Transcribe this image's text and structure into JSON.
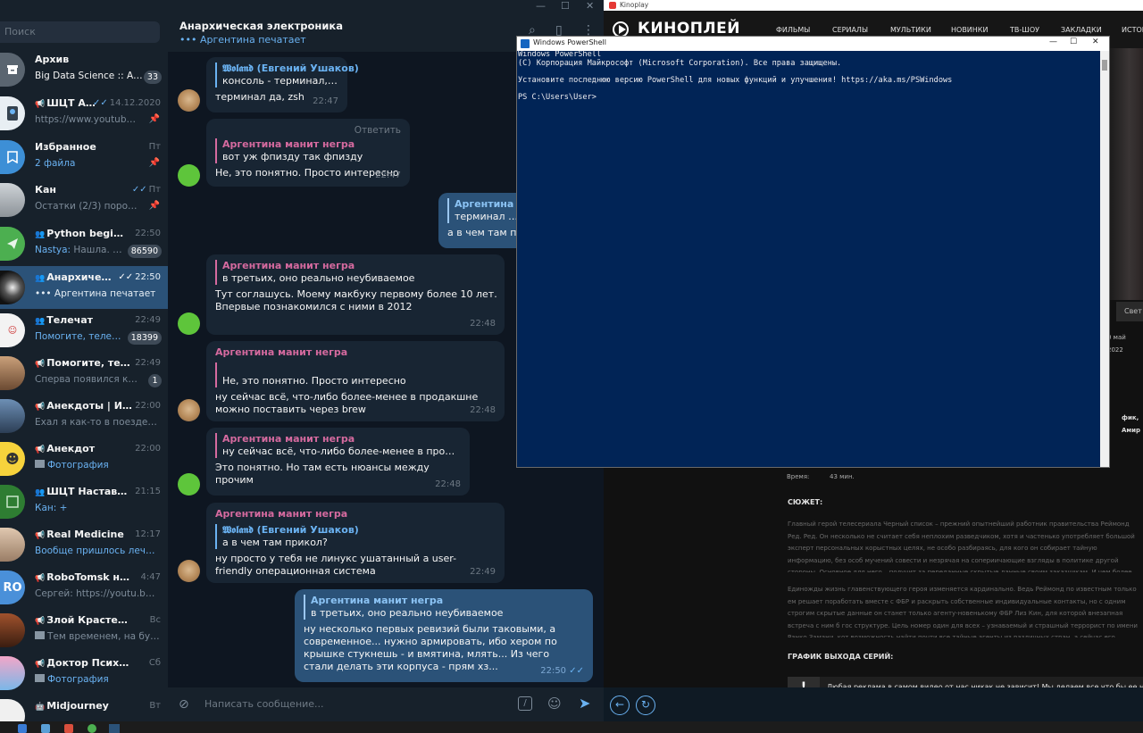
{
  "telegram": {
    "search_placeholder": "Поиск",
    "chats": [
      {
        "title": "Архив",
        "preview": "Big Data Science :: AI / ...",
        "badge": "33"
      },
      {
        "title": "ШЦТ Аси...",
        "time": "14.12.2020",
        "preview": "https://www.youtube.co..."
      },
      {
        "title": "Избранное",
        "time": "Пт",
        "preview": "2 файла"
      },
      {
        "title": "Кан",
        "time": "Пт",
        "preview": "Остатки (2/3) порошко..."
      },
      {
        "title": "Python beginners",
        "time": "22:50",
        "preview_sender": "Nastya:",
        "preview": "Нашла. Там...",
        "badge": "86590"
      },
      {
        "title": "Анархическая...",
        "time": "22:50",
        "preview": "••• Аргентина печатает"
      },
      {
        "title": "Телечат",
        "time": "22:49",
        "preview": "Помогите, телемед...",
        "badge": "18399"
      },
      {
        "title": "Помогите, телем...",
        "time": "22:49",
        "preview": "Сперва появился кише...",
        "badge": "1"
      },
      {
        "title": "Анекдоты | Исто...",
        "time": "22:00",
        "preview": "Ехал я как-то в поезде в ку..."
      },
      {
        "title": "Анекдот",
        "time": "22:00",
        "preview": "Фотография"
      },
      {
        "title": "ШЦТ Наставник...",
        "time": "21:15",
        "preview": "Кан: +"
      },
      {
        "title": "Real Medicine",
        "time": "12:17",
        "preview": "Вообще пришлось лечить ..."
      },
      {
        "title": "RoboTomsk новос...",
        "time": "4:47",
        "preview": "Сергей: https://youtu.be/3...",
        "avatar": "RO"
      },
      {
        "title": "Злой Крастер",
        "time": "Вс",
        "preview": "Тем временем, на буст..."
      },
      {
        "title": "Доктор Психтер",
        "time": "Сб",
        "preview": "Фотография"
      },
      {
        "title": "Midjourney",
        "time": "Вт",
        "preview": ""
      }
    ],
    "header": {
      "title": "Анархическая электроника",
      "status": "••• Аргентина печатает"
    },
    "messages": {
      "m1": {
        "reply_name": "𝖂𝖔𝖑𝖆𝖓𝖉 (Евгений Ушаков)",
        "reply_text": "консоль - терминал, в см...",
        "text": "терминал да, zsh",
        "time": "22:47"
      },
      "m2": {
        "reply_link": "Ответить",
        "reply_name": "Аргентина манит негра",
        "reply_text": "вот уж фпизду так фпизду",
        "text": "Не, это понятно. Просто интересно",
        "time": "22:47"
      },
      "m3": {
        "reply_name": "Аргентина ма",
        "reply_text": "терминал да, z",
        "text": "а в чем там при"
      },
      "m4": {
        "reply_name": "Аргентина манит негра",
        "reply_text": "в третьих, оно реально неубиваемое",
        "text": "Тут соглашусь. Моему макбуку первому более 10 лет. Впервые познакомился с ними в 2012",
        "time": "22:48"
      },
      "m5": {
        "sender": "Аргентина манит негра",
        "reply_text": "Не, это понятно. Просто интересно",
        "text": "ну сейчас всё, что-либо более-менее в продакшне можно поставить через brew",
        "time": "22:48"
      },
      "m6": {
        "reply_name": "Аргентина манит негра",
        "reply_text": "ну сейчас всё, что-либо более-менее в продакшне ...",
        "text": "Это понятно. Но там есть нюансы между прочим",
        "time": "22:48"
      },
      "m7": {
        "sender": "Аргентина манит негра",
        "reply_name": "𝖂𝖔𝖑𝖆𝖓𝖉 (Евгений Ушаков)",
        "reply_text": "а в чем там прикол?",
        "text": "ну просто у тебя не линукс ушатанный а user-friendly операционная система",
        "time": "22:49"
      },
      "m8": {
        "reply_name": "Аргентина манит негра",
        "reply_text": "в третьих, оно реально неубиваемое",
        "text": "ну несколько первых ревизий были таковыми, а современное... нужно армировать, ибо хером по крышке стукнешь - и вмятина, млять... Из чего стали делать эти корпуса - прям хз...",
        "time": "22:50"
      }
    },
    "composer_placeholder": "Написать сообщение..."
  },
  "kinoplay": {
    "window_title": "Kinoplay",
    "logo": "КИНОПЛЕЙ",
    "menu": [
      "ФИЛЬМЫ",
      "СЕРИАЛЫ",
      "МУЛЬТИКИ",
      "НОВИНКИ",
      "ТВ-ШОУ",
      "ЗАКЛАДКИ",
      "ИСТОР"
    ],
    "side_tab": "Свет",
    "date_fragment": "0 май 2022",
    "people_fragment": "фик, Амир",
    "duration_label": "Время:",
    "duration_value": "43 мин.",
    "plot_heading": "СЮЖЕТ:",
    "plot_p1": "Главный герой телесериала Черный список – прежний опытнейший работник правительства Реймонд Ред. Ред. Он несколько не считает себя неплохим разведчиком, хотя и частенько употребляет большой эксперт персональных корыстных целях, не особо разбираясь, для кого он собирает тайную информацию, без особ мучений совести и незрячая на сопериичающие взгляды в политике другой стороны. Основное для него – получит за переданные скрытые данные своим заказчикам. И чем более, тем лучше.",
    "plot_p2": "Единожды жизнь главенствующего героя изменяется кардинально. Ведь Реймонд по известным только ем решает поработать вместе с ФБР и раскрыть собственные индивидуальные контакты, но с одним строгим скрытые данные он станет только агенту-новенькому ФБР Лиз Кин, для которой внезапная встреча с ним б гос структуре. Цель номер один для всех – узнаваемый и страшный террорист по имени Ранко Замани, кот возможность найти почти все тайные агенты из различных стран, а сейчас его считают мертвым.",
    "schedule_heading": "ГРАФИК ВЫХОДА СЕРИЙ:",
    "banner_text": "Любая реклама в самом видео от нас никак не зависит! Мы делаем все что бы ее не было! При"
  },
  "powershell": {
    "title": "Windows PowerShell",
    "lines": [
      "Windows PowerShell",
      "(C) Корпорация Майкрософт (Microsoft Corporation). Все права защищены.",
      "",
      "Установите последнюю версию PowerShell для новых функций и улучшения! https://aka.ms/PSWindows",
      "",
      "PS C:\\Users\\User>"
    ]
  },
  "colors": {
    "tg_accent": "#6ab2f2",
    "tg_name_pink": "#d56a9f",
    "ps_background": "#012456"
  }
}
